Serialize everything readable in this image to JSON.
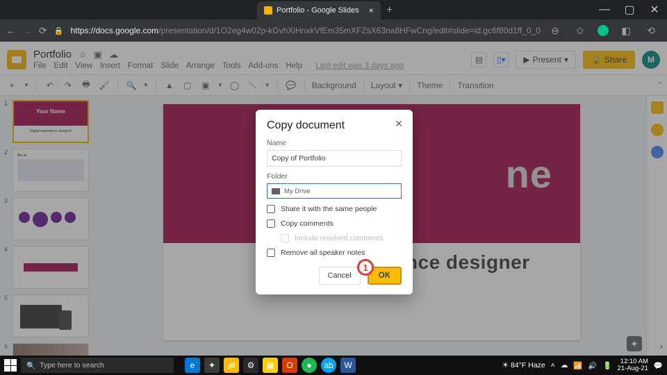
{
  "browser": {
    "tab_title": "Portfolio - Google Slides",
    "url_host": "https://docs.google.com",
    "url_path": "/presentation/d/1O2eg4w02p-kGvhXiHnxkVfEm35mXFZsX63na8HFwCng/edit#slide=id.gc6f80d1ff_0_0"
  },
  "doc": {
    "title": "Portfolio",
    "last_edit": "Last edit was 3 days ago",
    "menus": [
      "File",
      "Edit",
      "View",
      "Insert",
      "Format",
      "Slide",
      "Arrange",
      "Tools",
      "Add-ons",
      "Help"
    ],
    "present_label": "Present",
    "share_label": "Share",
    "avatar_initial": "M"
  },
  "toolbar": {
    "background": "Background",
    "layout": "Layout",
    "theme": "Theme",
    "transition": "Transition"
  },
  "slide": {
    "hero_text": "ne",
    "subtitle": "Digital experience designer",
    "thumb1_title": "Your Name",
    "thumb1_sub": "Digital experience designer"
  },
  "dialog": {
    "title": "Copy document",
    "name_label": "Name",
    "name_value": "Copy of Portfolio",
    "folder_label": "Folder",
    "folder_value": "My Drive",
    "share_same": "Share it with the same people",
    "copy_comments": "Copy comments",
    "include_resolved": "Include resolved comments",
    "remove_notes": "Remove all speaker notes",
    "cancel": "Cancel",
    "ok": "OK",
    "annotation": "1"
  },
  "taskbar": {
    "search_placeholder": "Type here to search",
    "weather": "84°F Haze",
    "time": "12:10 AM",
    "date": "21-Aug-21"
  }
}
